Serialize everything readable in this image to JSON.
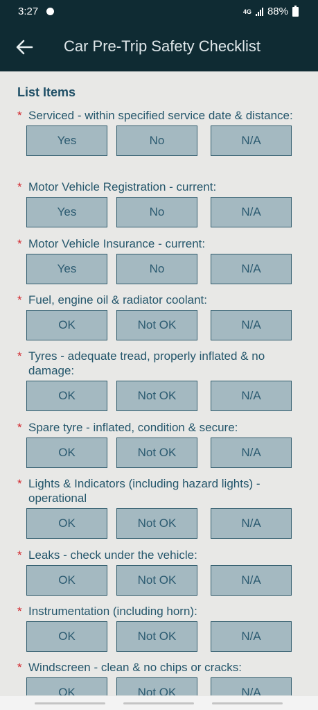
{
  "status_bar": {
    "time": "3:27",
    "network": "4G",
    "battery": "88%"
  },
  "app_bar": {
    "title": "Car Pre-Trip Safety Checklist"
  },
  "section_title": "List Items",
  "items": [
    {
      "label": "Serviced - within specified service date & distance:",
      "options": [
        "Yes",
        "No",
        "N/A"
      ]
    },
    {
      "label": "Motor Vehicle Registration - current:",
      "options": [
        "Yes",
        "No",
        "N/A"
      ]
    },
    {
      "label": "Motor Vehicle Insurance - current:",
      "options": [
        "Yes",
        "No",
        "N/A"
      ]
    },
    {
      "label": "Fuel, engine oil & radiator coolant:",
      "options": [
        "OK",
        "Not OK",
        "N/A"
      ]
    },
    {
      "label": "Tyres -  adequate tread, properly inflated & no damage:",
      "options": [
        "OK",
        "Not OK",
        "N/A"
      ]
    },
    {
      "label": "Spare tyre - inflated, condition & secure:",
      "options": [
        "OK",
        "Not OK",
        "N/A"
      ]
    },
    {
      "label": "Lights & Indicators (including hazard lights) - operational",
      "options": [
        "OK",
        "Not OK",
        "N/A"
      ]
    },
    {
      "label": "Leaks - check under the vehicle:",
      "options": [
        "OK",
        "Not OK",
        "N/A"
      ]
    },
    {
      "label": "Instrumentation (including horn):",
      "options": [
        "OK",
        "Not OK",
        "N/A"
      ]
    },
    {
      "label": "Windscreen - clean & no chips or cracks:",
      "options": [
        "OK",
        "Not OK",
        "N/A"
      ]
    }
  ],
  "required_marker": "*"
}
